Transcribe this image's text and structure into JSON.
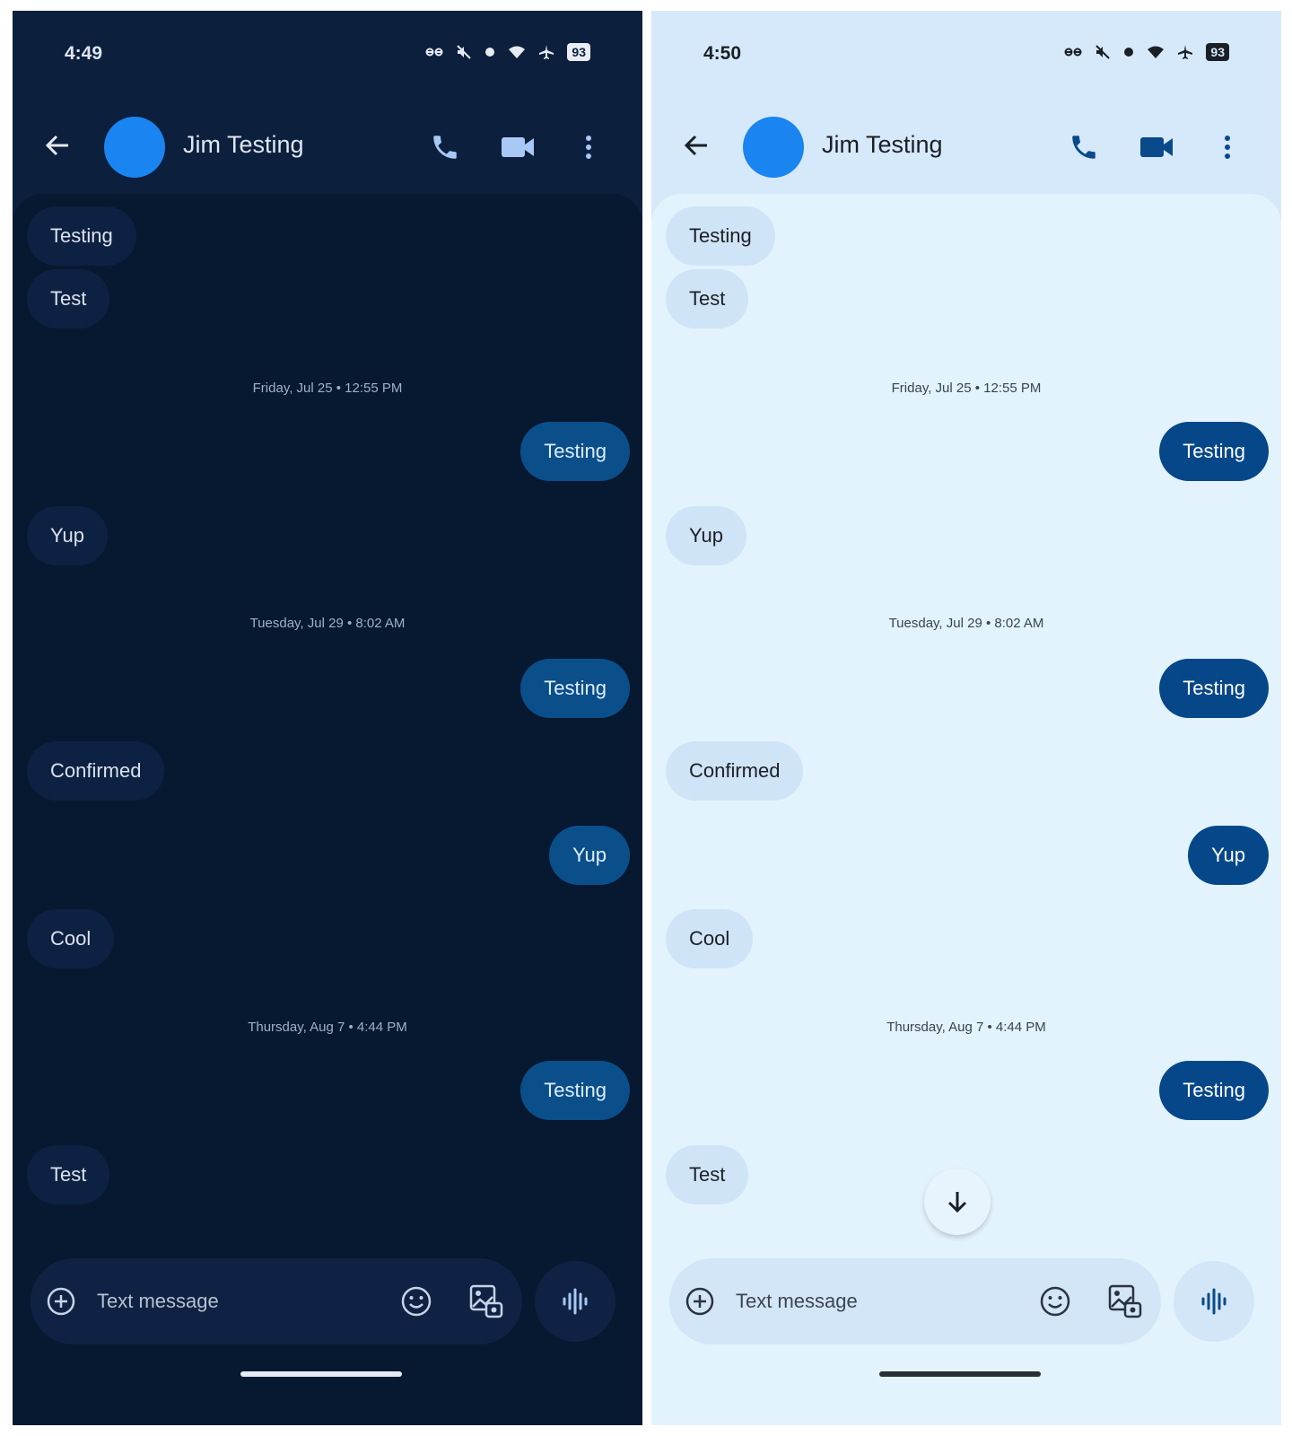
{
  "screens": [
    {
      "theme": "dark",
      "status_bar": {
        "time": "4:49",
        "battery": "93"
      },
      "contact": {
        "name": "Jim Testing"
      },
      "timestamps": [
        "Friday, Jul 25 • 12:55 PM",
        "Tuesday, Jul 29 • 8:02 AM",
        "Thursday, Aug 7 • 4:44 PM"
      ],
      "messages": [
        {
          "dir": "in",
          "text": "Testing"
        },
        {
          "dir": "in",
          "text": "Test"
        },
        {
          "dir": "out",
          "text": "Testing"
        },
        {
          "dir": "in",
          "text": "Yup"
        },
        {
          "dir": "out",
          "text": "Testing"
        },
        {
          "dir": "in",
          "text": "Confirmed"
        },
        {
          "dir": "out",
          "text": "Yup"
        },
        {
          "dir": "in",
          "text": "Cool"
        },
        {
          "dir": "out",
          "text": "Testing"
        },
        {
          "dir": "in",
          "text": "Test"
        }
      ],
      "compose": {
        "placeholder": "Text message"
      }
    },
    {
      "theme": "light",
      "status_bar": {
        "time": "4:50",
        "battery": "93"
      },
      "contact": {
        "name": "Jim Testing"
      },
      "timestamps": [
        "Friday, Jul 25 • 12:55 PM",
        "Tuesday, Jul 29 • 8:02 AM",
        "Thursday, Aug 7 • 4:44 PM"
      ],
      "messages": [
        {
          "dir": "in",
          "text": "Testing"
        },
        {
          "dir": "in",
          "text": "Test"
        },
        {
          "dir": "out",
          "text": "Testing"
        },
        {
          "dir": "in",
          "text": "Yup"
        },
        {
          "dir": "out",
          "text": "Testing"
        },
        {
          "dir": "in",
          "text": "Confirmed"
        },
        {
          "dir": "out",
          "text": "Yup"
        },
        {
          "dir": "in",
          "text": "Cool"
        },
        {
          "dir": "out",
          "text": "Testing"
        },
        {
          "dir": "in",
          "text": "Test"
        }
      ],
      "compose": {
        "placeholder": "Text message"
      }
    }
  ],
  "icons": {
    "back": "arrow-left-icon",
    "call": "phone-icon",
    "video": "video-camera-icon",
    "more": "more-vert-icon",
    "add": "plus-circle-icon",
    "emoji": "emoji-icon",
    "gallery": "gallery-icon",
    "voice": "waveform-icon",
    "scroll": "arrow-down-icon"
  },
  "colors": {
    "avatar": "#1a84f0",
    "dark_background": "#0c1f3d",
    "dark_outgoing_bubble": "#0a4f8a",
    "light_background": "#d6e9fa",
    "light_outgoing_bubble": "#054789"
  }
}
